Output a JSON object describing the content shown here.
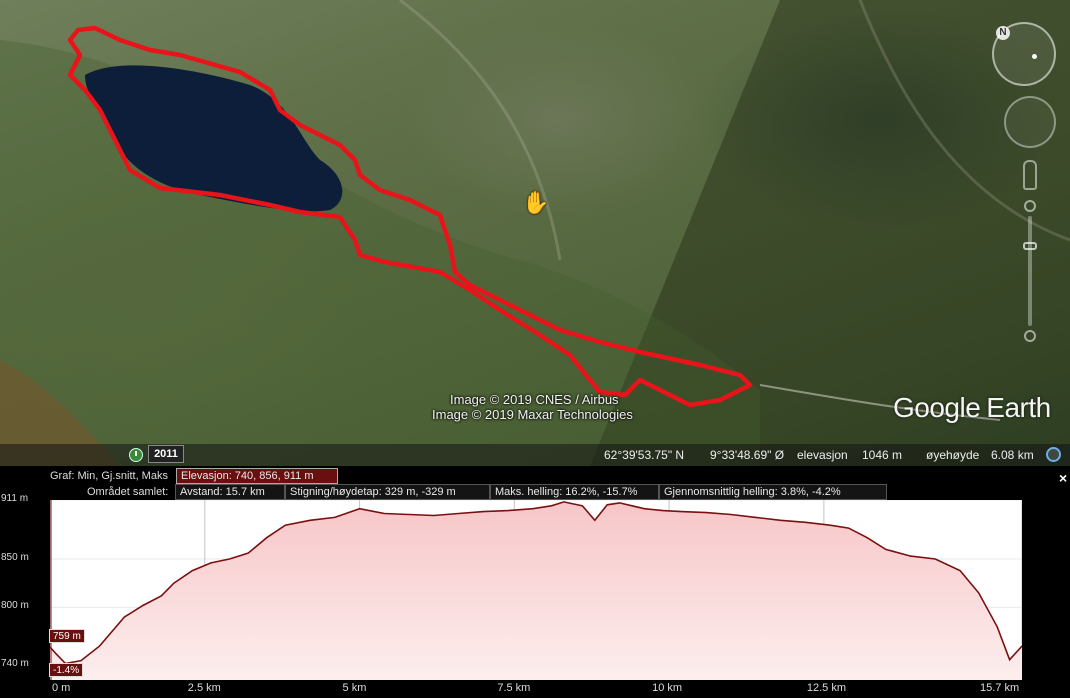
{
  "map": {
    "credit_line_1": "Image © 2019 CNES / Airbus",
    "credit_line_2": "Image © 2019 Maxar Technologies",
    "brand_google": "Google",
    "brand_earth": "Earth",
    "compass_letter": "N",
    "year_badge": "2011",
    "route_color": "#e8141a",
    "lake_color": "#0d1e3a"
  },
  "status": {
    "latitude": "62°39'53.75\" N",
    "longitude": "9°33'48.69\" Ø",
    "elevation_label": "elevasjon",
    "elevation_value": "1046 m",
    "eye_alt_label": "øyehøyde",
    "eye_alt_value": "6.08 km"
  },
  "panel": {
    "graph_label": "Graf: Min, Gj.snitt, Maks",
    "graph_value": "Elevasjon: 740, 856, 911 m",
    "area_label": "Området samlet:",
    "distance": "Avstand: 15.7 km",
    "gain_loss": "Stigning/høydetap: 329 m, -329 m",
    "max_slope": "Maks. helling: 16.2%, -15.7%",
    "avg_slope": "Gjennomsnittlig helling: 3.8%, -4.2%",
    "close": "×"
  },
  "chart_data": {
    "type": "area",
    "x_unit": "km",
    "y_unit": "m",
    "xlim": [
      0,
      15.7
    ],
    "ylim": [
      725,
      911
    ],
    "y_ticks": [
      {
        "value": 911,
        "label": "911 m"
      },
      {
        "value": 850,
        "label": "850 m"
      },
      {
        "value": 800,
        "label": "800 m"
      },
      {
        "value": 740,
        "label": "740 m"
      }
    ],
    "x_ticks": [
      {
        "value": 0,
        "label": "0 m"
      },
      {
        "value": 2.5,
        "label": "2.5 km"
      },
      {
        "value": 5,
        "label": "5 km"
      },
      {
        "value": 7.5,
        "label": "7.5 km"
      },
      {
        "value": 10,
        "label": "10 km"
      },
      {
        "value": 12.5,
        "label": "12.5 km"
      },
      {
        "value": 15.7,
        "label": "15.7 km"
      }
    ],
    "cursor_elevation": "759 m",
    "cursor_slope": "-1.4%",
    "line_color": "#7a1010",
    "fill_top": "#f7c6c8",
    "fill_bottom": "#fdeeee",
    "x": [
      0,
      0.1,
      0.25,
      0.5,
      0.8,
      1.0,
      1.2,
      1.5,
      1.8,
      2.0,
      2.3,
      2.6,
      2.9,
      3.2,
      3.5,
      3.8,
      4.2,
      4.6,
      5.0,
      5.4,
      5.8,
      6.2,
      6.6,
      7.0,
      7.4,
      7.8,
      8.1,
      8.3,
      8.6,
      8.8,
      9.0,
      9.2,
      9.4,
      9.6,
      9.9,
      10.2,
      10.6,
      11.0,
      11.4,
      11.8,
      12.2,
      12.6,
      12.9,
      13.2,
      13.5,
      13.9,
      14.3,
      14.7,
      15.0,
      15.3,
      15.5,
      15.7
    ],
    "y": [
      759,
      752,
      742,
      745,
      760,
      775,
      790,
      802,
      812,
      825,
      838,
      846,
      850,
      856,
      872,
      885,
      890,
      893,
      902,
      897,
      896,
      895,
      897,
      899,
      900,
      902,
      905,
      909,
      905,
      890,
      906,
      908,
      905,
      902,
      900,
      899,
      898,
      896,
      893,
      890,
      888,
      885,
      882,
      872,
      860,
      853,
      850,
      838,
      815,
      780,
      746,
      760
    ]
  }
}
